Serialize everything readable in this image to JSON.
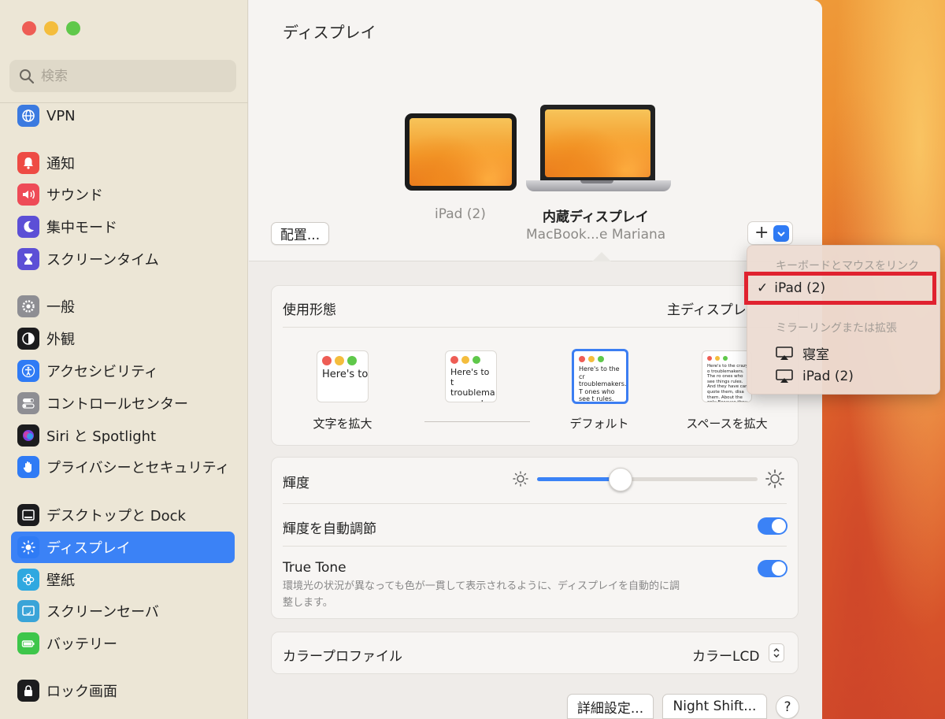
{
  "sidebar": {
    "search_placeholder": "検索",
    "items": [
      {
        "label": "VPN",
        "icon": "globe-icon",
        "color": "#3b7ae0"
      },
      {
        "label": "通知",
        "icon": "bell-icon",
        "color": "#ee4b44"
      },
      {
        "label": "サウンド",
        "icon": "speaker-icon",
        "color": "#ee4b57"
      },
      {
        "label": "集中モード",
        "icon": "moon-icon",
        "color": "#5c4fd6"
      },
      {
        "label": "スクリーンタイム",
        "icon": "hourglass-icon",
        "color": "#5c4fd6"
      },
      {
        "label": "一般",
        "icon": "gear-icon",
        "color": "#8e8e93"
      },
      {
        "label": "外観",
        "icon": "appearance-icon",
        "color": "#1c1c1e"
      },
      {
        "label": "アクセシビリティ",
        "icon": "accessibility-icon",
        "color": "#2f7bf5"
      },
      {
        "label": "コントロールセンター",
        "icon": "toggles-icon",
        "color": "#8e8e93"
      },
      {
        "label": "Siri と Spotlight",
        "icon": "siri-icon",
        "color": "#1c1c1e"
      },
      {
        "label": "プライバシーとセキュリティ",
        "icon": "hand-icon",
        "color": "#2f7bf5"
      },
      {
        "label": "デスクトップと Dock",
        "icon": "dock-icon",
        "color": "#1c1c1e"
      },
      {
        "label": "ディスプレイ",
        "icon": "sun-icon",
        "color": "#2f7bf5"
      },
      {
        "label": "壁紙",
        "icon": "flower-icon",
        "color": "#2fa8e0"
      },
      {
        "label": "スクリーンセーバ",
        "icon": "screensaver-icon",
        "color": "#3aa4d8"
      },
      {
        "label": "バッテリー",
        "icon": "battery-icon",
        "color": "#3ec64a"
      },
      {
        "label": "ロック画面",
        "icon": "lock-icon",
        "color": "#1c1c1e"
      }
    ]
  },
  "main": {
    "title": "ディスプレイ",
    "arrange_label": "配置...",
    "add_label": "+",
    "ipad_label": "iPad (2)",
    "mac_label": "内蔵ディスプレイ",
    "mac_sub": "MacBook...e Mariana"
  },
  "usage": {
    "label": "使用形態",
    "value": "主ディスプレ",
    "options": [
      {
        "caption": "文字を拡大",
        "sample": "Here's to troublem"
      },
      {
        "caption": "",
        "sample": "Here's to t troublema ones who"
      },
      {
        "caption": "デフォルト",
        "sample": "Here's to the cr troublemakers. T ones who see t rules. And they"
      },
      {
        "caption": "スペースを拡大",
        "sample": "Here's to the crazy o troublemakers. The ro ones who see things rules. And they have can quote them, disa them. About the only Because they change"
      }
    ]
  },
  "brightness": {
    "label": "輝度",
    "level": 0.38,
    "auto_label": "輝度を自動調節",
    "auto_on": true,
    "truetone_label": "True Tone",
    "truetone_on": true,
    "truetone_desc_1": "環境光の状況が異なっても色が一貫して表示されるように、ディスプレイを自動的に調",
    "truetone_desc_2": "整します。"
  },
  "color_profile": {
    "label": "カラープロファイル",
    "value": "カラーLCD"
  },
  "footer": {
    "advanced_label": "詳細設定...",
    "nightshift_label": "Night Shift...",
    "help_label": "?"
  },
  "menu": {
    "heading_link": "キーボードとマウスをリンク",
    "checked_item": "iPad (2)",
    "check_mark": "✓",
    "heading_mirror": "ミラーリングまたは拡張",
    "items": [
      "寝室",
      "iPad (2)"
    ]
  },
  "colors": {
    "accent": "#3b82f6",
    "highlight_box": "#e0222f"
  }
}
